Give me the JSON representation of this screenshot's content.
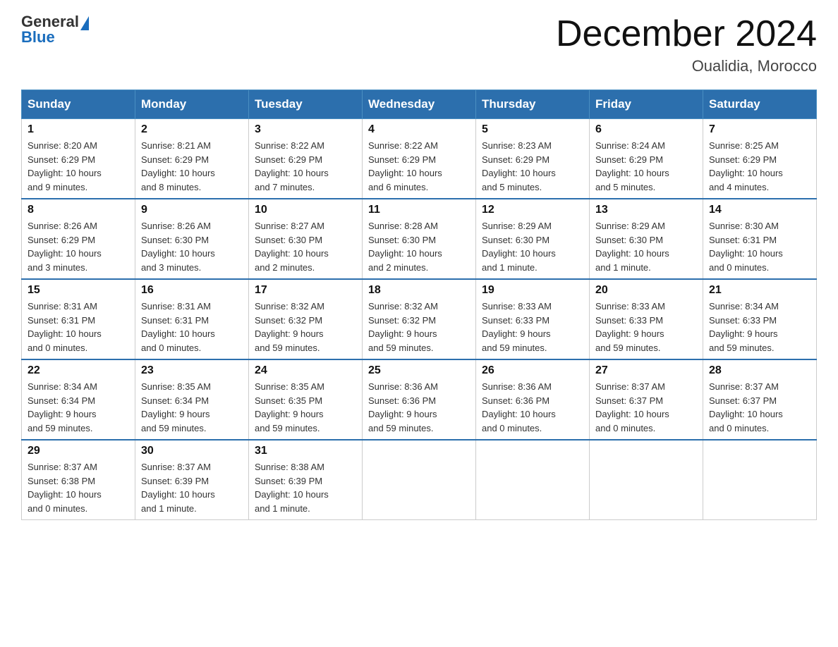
{
  "header": {
    "logo_general": "General",
    "logo_blue": "Blue",
    "title": "December 2024",
    "subtitle": "Oualidia, Morocco"
  },
  "days_header": [
    "Sunday",
    "Monday",
    "Tuesday",
    "Wednesday",
    "Thursday",
    "Friday",
    "Saturday"
  ],
  "weeks": [
    [
      {
        "day": "1",
        "info": "Sunrise: 8:20 AM\nSunset: 6:29 PM\nDaylight: 10 hours\nand 9 minutes."
      },
      {
        "day": "2",
        "info": "Sunrise: 8:21 AM\nSunset: 6:29 PM\nDaylight: 10 hours\nand 8 minutes."
      },
      {
        "day": "3",
        "info": "Sunrise: 8:22 AM\nSunset: 6:29 PM\nDaylight: 10 hours\nand 7 minutes."
      },
      {
        "day": "4",
        "info": "Sunrise: 8:22 AM\nSunset: 6:29 PM\nDaylight: 10 hours\nand 6 minutes."
      },
      {
        "day": "5",
        "info": "Sunrise: 8:23 AM\nSunset: 6:29 PM\nDaylight: 10 hours\nand 5 minutes."
      },
      {
        "day": "6",
        "info": "Sunrise: 8:24 AM\nSunset: 6:29 PM\nDaylight: 10 hours\nand 5 minutes."
      },
      {
        "day": "7",
        "info": "Sunrise: 8:25 AM\nSunset: 6:29 PM\nDaylight: 10 hours\nand 4 minutes."
      }
    ],
    [
      {
        "day": "8",
        "info": "Sunrise: 8:26 AM\nSunset: 6:29 PM\nDaylight: 10 hours\nand 3 minutes."
      },
      {
        "day": "9",
        "info": "Sunrise: 8:26 AM\nSunset: 6:30 PM\nDaylight: 10 hours\nand 3 minutes."
      },
      {
        "day": "10",
        "info": "Sunrise: 8:27 AM\nSunset: 6:30 PM\nDaylight: 10 hours\nand 2 minutes."
      },
      {
        "day": "11",
        "info": "Sunrise: 8:28 AM\nSunset: 6:30 PM\nDaylight: 10 hours\nand 2 minutes."
      },
      {
        "day": "12",
        "info": "Sunrise: 8:29 AM\nSunset: 6:30 PM\nDaylight: 10 hours\nand 1 minute."
      },
      {
        "day": "13",
        "info": "Sunrise: 8:29 AM\nSunset: 6:30 PM\nDaylight: 10 hours\nand 1 minute."
      },
      {
        "day": "14",
        "info": "Sunrise: 8:30 AM\nSunset: 6:31 PM\nDaylight: 10 hours\nand 0 minutes."
      }
    ],
    [
      {
        "day": "15",
        "info": "Sunrise: 8:31 AM\nSunset: 6:31 PM\nDaylight: 10 hours\nand 0 minutes."
      },
      {
        "day": "16",
        "info": "Sunrise: 8:31 AM\nSunset: 6:31 PM\nDaylight: 10 hours\nand 0 minutes."
      },
      {
        "day": "17",
        "info": "Sunrise: 8:32 AM\nSunset: 6:32 PM\nDaylight: 9 hours\nand 59 minutes."
      },
      {
        "day": "18",
        "info": "Sunrise: 8:32 AM\nSunset: 6:32 PM\nDaylight: 9 hours\nand 59 minutes."
      },
      {
        "day": "19",
        "info": "Sunrise: 8:33 AM\nSunset: 6:33 PM\nDaylight: 9 hours\nand 59 minutes."
      },
      {
        "day": "20",
        "info": "Sunrise: 8:33 AM\nSunset: 6:33 PM\nDaylight: 9 hours\nand 59 minutes."
      },
      {
        "day": "21",
        "info": "Sunrise: 8:34 AM\nSunset: 6:33 PM\nDaylight: 9 hours\nand 59 minutes."
      }
    ],
    [
      {
        "day": "22",
        "info": "Sunrise: 8:34 AM\nSunset: 6:34 PM\nDaylight: 9 hours\nand 59 minutes."
      },
      {
        "day": "23",
        "info": "Sunrise: 8:35 AM\nSunset: 6:34 PM\nDaylight: 9 hours\nand 59 minutes."
      },
      {
        "day": "24",
        "info": "Sunrise: 8:35 AM\nSunset: 6:35 PM\nDaylight: 9 hours\nand 59 minutes."
      },
      {
        "day": "25",
        "info": "Sunrise: 8:36 AM\nSunset: 6:36 PM\nDaylight: 9 hours\nand 59 minutes."
      },
      {
        "day": "26",
        "info": "Sunrise: 8:36 AM\nSunset: 6:36 PM\nDaylight: 10 hours\nand 0 minutes."
      },
      {
        "day": "27",
        "info": "Sunrise: 8:37 AM\nSunset: 6:37 PM\nDaylight: 10 hours\nand 0 minutes."
      },
      {
        "day": "28",
        "info": "Sunrise: 8:37 AM\nSunset: 6:37 PM\nDaylight: 10 hours\nand 0 minutes."
      }
    ],
    [
      {
        "day": "29",
        "info": "Sunrise: 8:37 AM\nSunset: 6:38 PM\nDaylight: 10 hours\nand 0 minutes."
      },
      {
        "day": "30",
        "info": "Sunrise: 8:37 AM\nSunset: 6:39 PM\nDaylight: 10 hours\nand 1 minute."
      },
      {
        "day": "31",
        "info": "Sunrise: 8:38 AM\nSunset: 6:39 PM\nDaylight: 10 hours\nand 1 minute."
      },
      {
        "day": "",
        "info": ""
      },
      {
        "day": "",
        "info": ""
      },
      {
        "day": "",
        "info": ""
      },
      {
        "day": "",
        "info": ""
      }
    ]
  ]
}
